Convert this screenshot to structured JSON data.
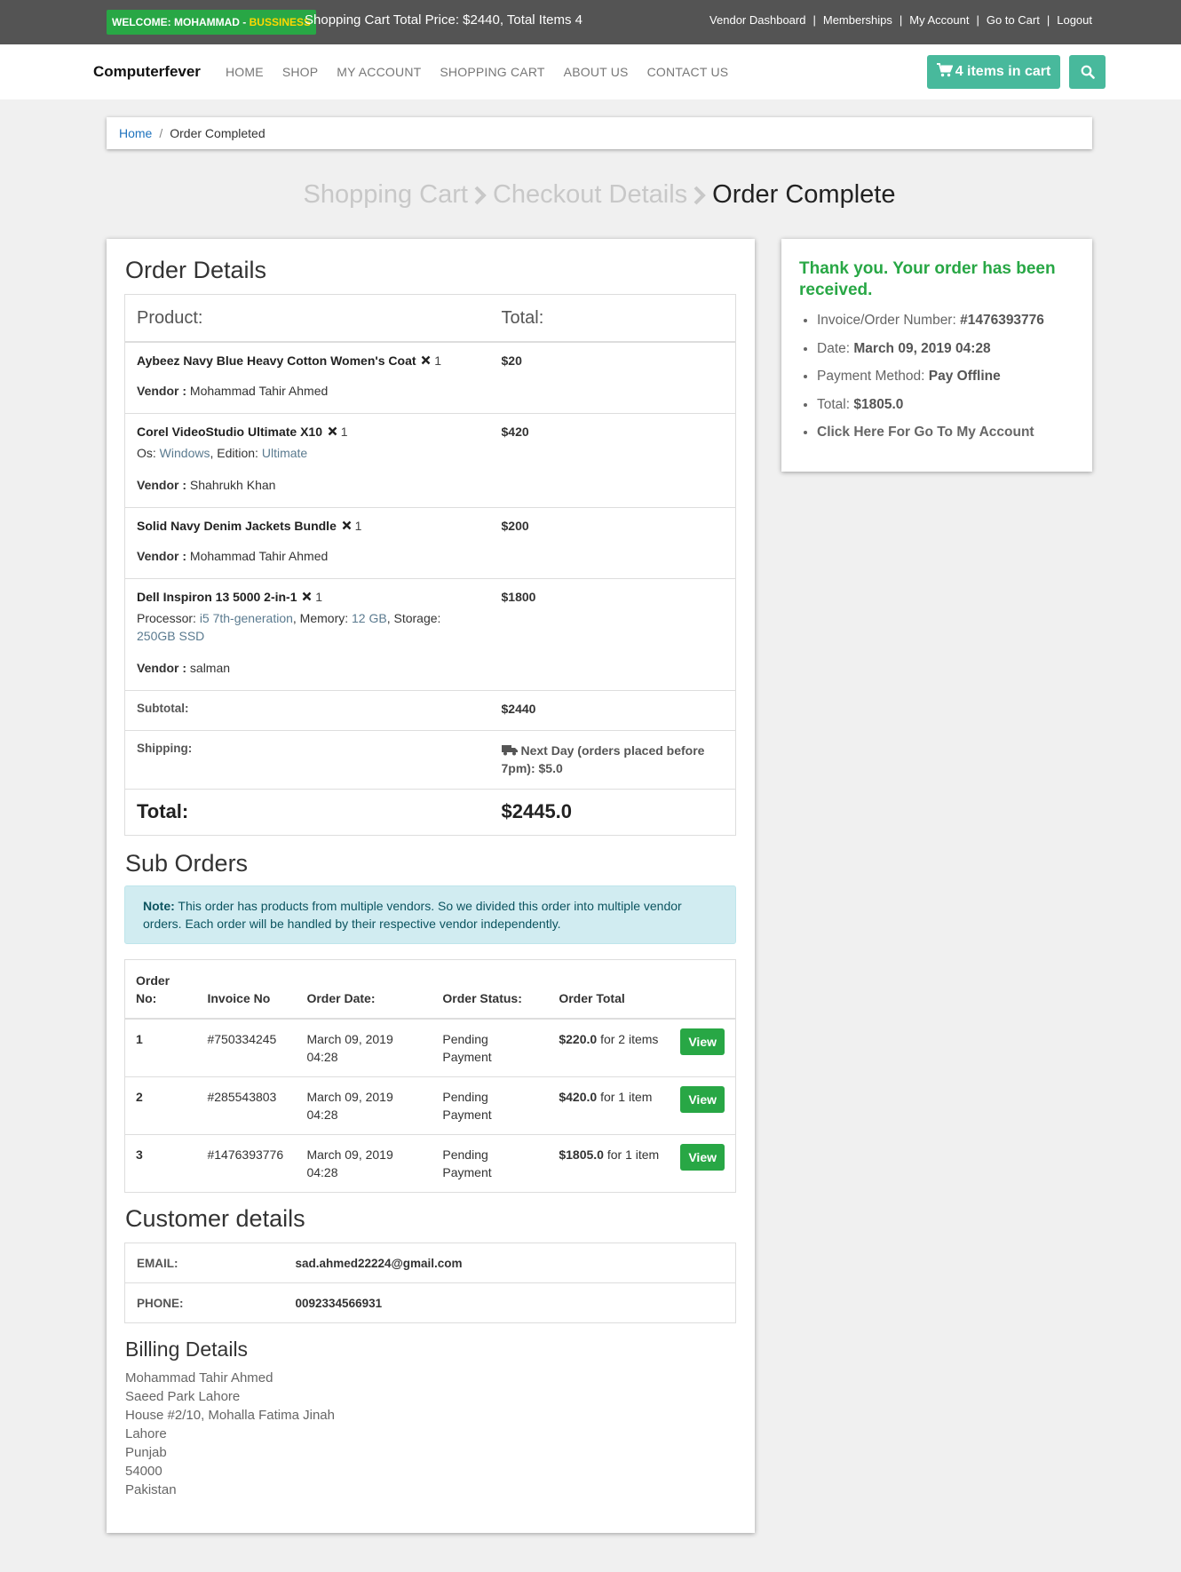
{
  "topbar": {
    "welcome_prefix": "WELCOME: MOHAMMAD - ",
    "welcome_role": "BUSSINESS",
    "cart_summary": "Shopping Cart Total Price: $2440, Total Items 4",
    "links": [
      "Vendor Dashboard",
      "Memberships",
      "My Account",
      "Go to Cart",
      "Logout"
    ]
  },
  "nav": {
    "brand": "Computerfever",
    "menu": [
      "HOME",
      "SHOP",
      "MY ACCOUNT",
      "SHOPPING CART",
      "ABOUT US",
      "CONTACT US"
    ],
    "cart_button": "4 items in cart"
  },
  "breadcrumb": {
    "home": "Home",
    "current": "Order Completed"
  },
  "steps": {
    "step1": "Shopping Cart",
    "step2": "Checkout Details",
    "step3": "Order Complete"
  },
  "order": {
    "heading": "Order Details",
    "col_product": "Product:",
    "col_total": "Total:",
    "items": [
      {
        "name": "Aybeez Navy Blue Heavy Cotton Women's Coat",
        "qty": "1",
        "vendor_label": "Vendor :",
        "vendor": "Mohammad Tahir Ahmed",
        "total": "$20"
      },
      {
        "name": "Corel VideoStudio Ultimate X10",
        "qty": "1",
        "attr_os_label": "Os:",
        "attr_os": "Windows",
        "attr_edition_label": "Edition:",
        "attr_edition": "Ultimate",
        "vendor_label": "Vendor :",
        "vendor": "Shahrukh Khan",
        "total": "$420"
      },
      {
        "name": "Solid Navy Denim Jackets Bundle",
        "qty": "1",
        "vendor_label": "Vendor :",
        "vendor": "Mohammad Tahir Ahmed",
        "total": "$200"
      },
      {
        "name": "Dell Inspiron 13 5000 2-in-1",
        "qty": "1",
        "attr_proc_label": "Processor:",
        "attr_proc": "i5 7th-generation",
        "attr_mem_label": "Memory:",
        "attr_mem": "12 GB",
        "attr_stor_label": "Storage:",
        "attr_stor": "250GB SSD",
        "vendor_label": "Vendor :",
        "vendor": "salman",
        "total": "$1800"
      }
    ],
    "subtotal_label": "Subtotal:",
    "subtotal": "$2440",
    "shipping_label": "Shipping:",
    "shipping": "Next Day (orders placed before 7pm): $5.0",
    "total_label": "Total:",
    "total": "$2445.0"
  },
  "suborders": {
    "heading": "Sub Orders",
    "note_label": "Note:",
    "note": "This order has products from multiple vendors. So we divided this order into multiple vendor orders. Each order will be handled by their respective vendor independently.",
    "headers": [
      "Order No:",
      "Invoice No",
      "Order Date:",
      "Order Status:",
      "Order Total"
    ],
    "rows": [
      {
        "no": "1",
        "invoice": "#750334245",
        "date": "March 09, 2019 04:28",
        "status": "Pending Payment",
        "total": "$220.0",
        "items": "for 2 items",
        "action": "View"
      },
      {
        "no": "2",
        "invoice": "#285543803",
        "date": "March 09, 2019 04:28",
        "status": "Pending Payment",
        "total": "$420.0",
        "items": "for 1 item",
        "action": "View"
      },
      {
        "no": "3",
        "invoice": "#1476393776",
        "date": "March 09, 2019 04:28",
        "status": "Pending Payment",
        "total": "$1805.0",
        "items": "for 1 item",
        "action": "View"
      }
    ]
  },
  "customer": {
    "heading": "Customer details",
    "email_label": "EMAIL:",
    "email": "sad.ahmed22224@gmail.com",
    "phone_label": "PHONE:",
    "phone": "0092334566931"
  },
  "billing": {
    "heading": "Billing Details",
    "lines": [
      "Mohammad Tahir Ahmed",
      "Saeed Park Lahore",
      "House #2/10, Mohalla Fatima Jinah",
      "Lahore",
      "Punjab",
      "54000",
      "Pakistan"
    ]
  },
  "summary": {
    "thanks": "Thank you. Your order has been received.",
    "invoice_label": "Invoice/Order Number:",
    "invoice": "#1476393776",
    "date_label": "Date:",
    "date": "March 09, 2019 04:28",
    "payment_label": "Payment Method:",
    "payment": "Pay Offline",
    "total_label": "Total:",
    "total": "$1805.0",
    "account_link": "Click Here For Go To My Account"
  },
  "colors": {
    "accent_green": "#28a745",
    "teal": "#48b99c",
    "topbar": "#545454",
    "note_bg": "#d1ecf1"
  },
  "icons": [
    "cart-icon",
    "search-icon",
    "chevron-right-icon",
    "times-icon",
    "truck-icon"
  ]
}
